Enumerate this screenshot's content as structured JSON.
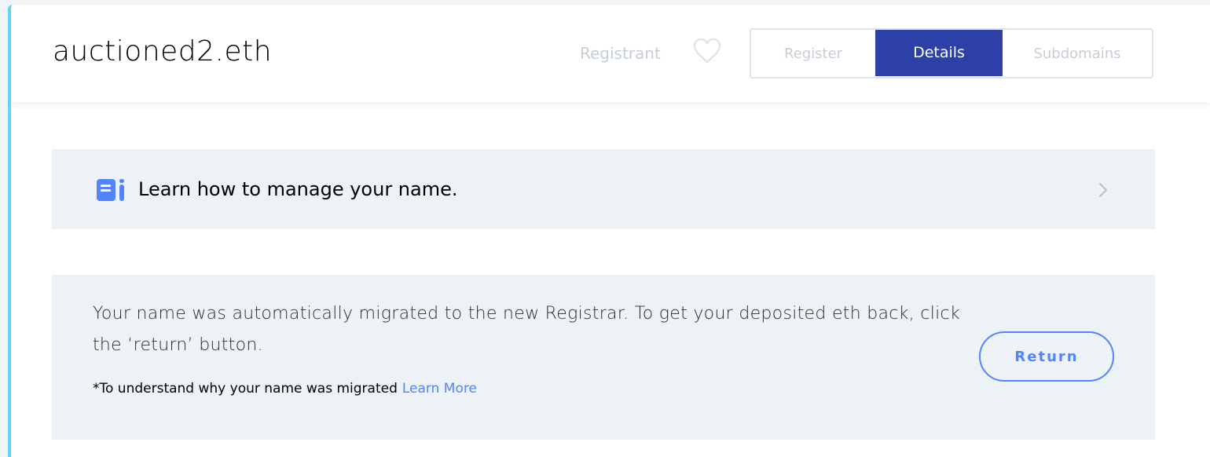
{
  "header": {
    "domain_name": "auctioned2.eth",
    "registrant_label": "Registrant",
    "tabs": [
      {
        "label": "Register",
        "active": false
      },
      {
        "label": "Details",
        "active": true
      },
      {
        "label": "Subdomains",
        "active": false
      }
    ],
    "favorite_icon": "heart-outline-icon"
  },
  "learn_banner": {
    "icon": "book-pencil-icon",
    "text": "Learn how to manage your name.",
    "chevron_icon": "chevron-right-icon"
  },
  "migration_notice": {
    "message": "Your name was automatically migrated to the new Registrar. To get your deposited eth back, click the ‘return’ button.",
    "note_prefix": "*To understand why your name was migrated",
    "learn_more_label": "Learn More",
    "return_button_label": "Return"
  },
  "colors": {
    "accent_blue": "#5284ff",
    "active_tab": "#2d40a8",
    "side_bar": "#5fd6f5",
    "panel_bg": "#edf2f6",
    "muted_text": "#c6cdd5"
  }
}
